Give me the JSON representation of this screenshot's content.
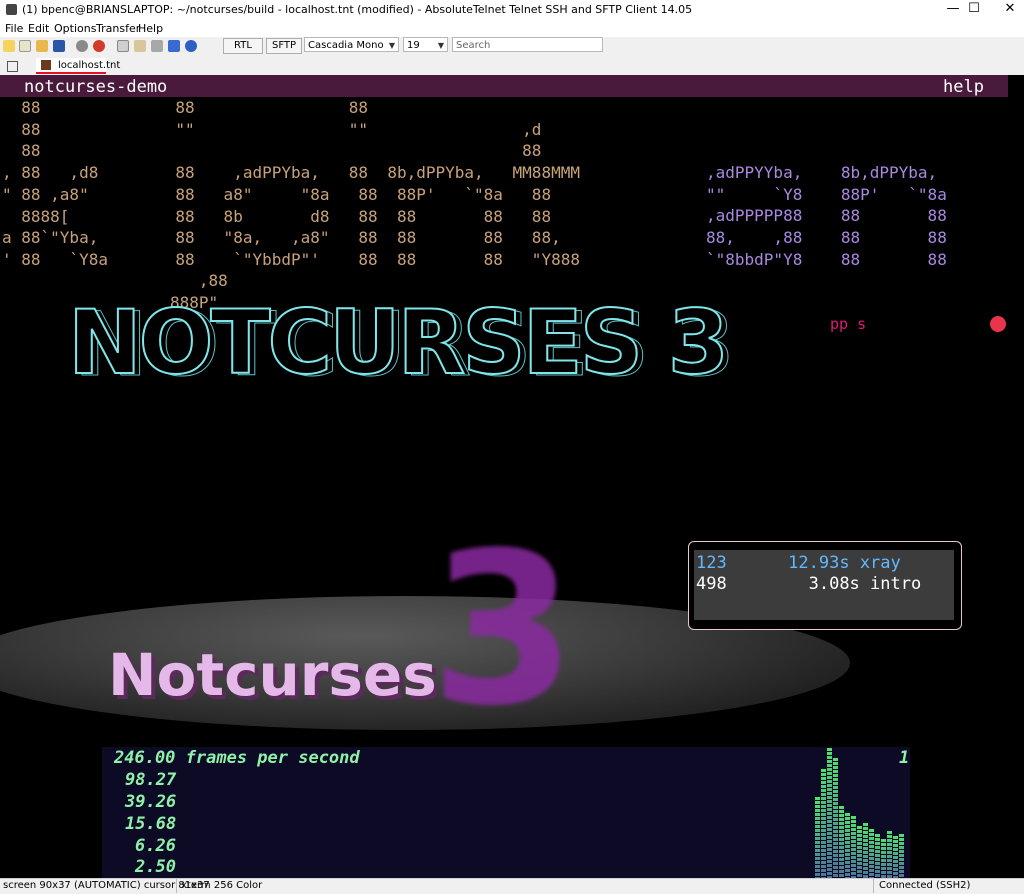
{
  "window": {
    "title": "(1) bpenc@BRIANSLAPTOP: ~/notcurses/build - localhost.tnt (modified) - AbsoluteTelnet Telnet SSH and SFTP Client 14.05",
    "controls": {
      "minimize": "—",
      "maximize": "☐",
      "close": "✕"
    }
  },
  "menu": [
    "File",
    "Edit",
    "Options",
    "Transfer",
    "Help"
  ],
  "toolbar": {
    "icons": [
      "new-icon",
      "open-folder-icon",
      "folder-icon",
      "save-icon",
      "check-icon",
      "disconnect-icon",
      "copy-icon",
      "paste-icon",
      "print-icon",
      "wrap-icon",
      "help-icon"
    ],
    "rtl_label": "RTL",
    "sftp_label": "SFTP",
    "font_name": "Cascadia Mono",
    "font_size": "19",
    "search_placeholder": "Search"
  },
  "tabs": {
    "grid_icon": "grid-icon",
    "session_tab": "localhost.tnt"
  },
  "terminal": {
    "header_left": "notcurses-demo",
    "header_right": "help",
    "art_orange": "  88              88                88\n  88              \"\"                \"\"                ,d\n  88                                                  88\n, 88   ,d8        88    ,adPPYba,   88  8b,dPPYba,   MM88MMM\n\" 88 ,a8\"         88   a8\"     \"8a   88  88P'   `\"8a   88\n  8888[           88   8b       d8   88  88       88   88\na 88`\"Yba,        88   \"8a,   ,a8\"   88  88       88   88,\n' 88   `Y8a       88    `\"YbbdP\"'    88  88       88   \"Y888",
    "art_purple": ",adPPYYba,    8b,dPPYba,\n\"\"     `Y8    88P'   `\"8a\n,adPPPPP88    88       88\n88,    ,88    88       88\n`\"8bbdP\"Y8    88       88",
    "art_tail": "   ,88\n888P\"",
    "big_title": "NOTCURSES 3",
    "pink_text": "pp      s",
    "notcurses_word": "Notcurses",
    "big_three": "3"
  },
  "timing": [
    {
      "count": "123",
      "time": "12.93s",
      "name": "xray"
    },
    {
      "count": "498",
      "time": "3.08s",
      "name": "intro"
    }
  ],
  "fps_plot": {
    "header": "246.00 frames per second",
    "ticks": [
      "98.27",
      "39.26",
      "15.68",
      "6.26",
      "2.50"
    ],
    "max_label": "1",
    "colors": {
      "top": "#8ff0a8",
      "bottom": "#8a7ae8"
    },
    "bar_levels": [
      0.62,
      0.84,
      1.0,
      0.92,
      0.55,
      0.5,
      0.48,
      0.4,
      0.42,
      0.38,
      0.34,
      0.3,
      0.36,
      0.32,
      0.34
    ]
  },
  "status": {
    "screen": "screen 90x37 (AUTOMATIC) cursor 81x37",
    "terminal_type": "xterm 256 Color",
    "connection": "Connected (SSH2)"
  }
}
